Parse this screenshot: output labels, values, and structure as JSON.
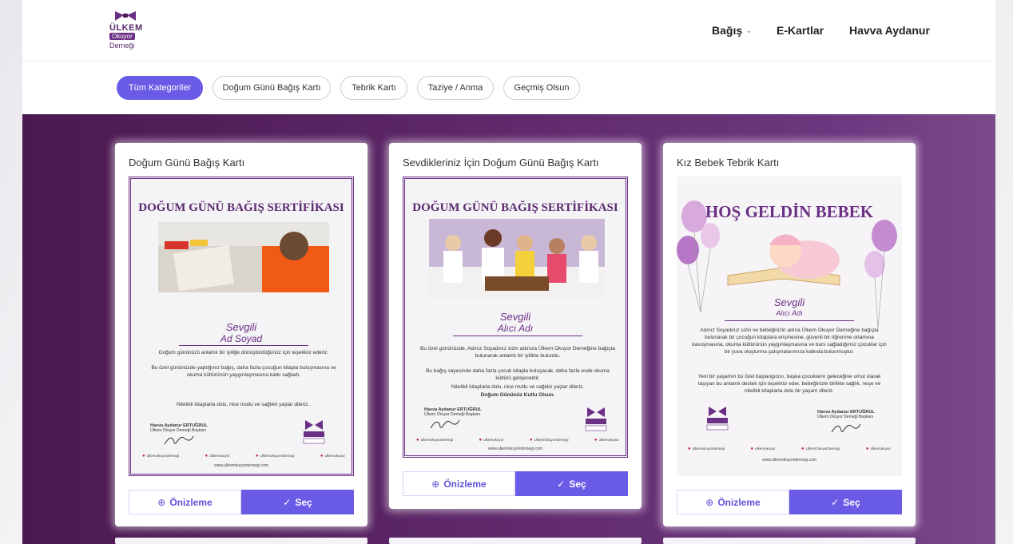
{
  "brand": {
    "logo_line1": "ÜLKEM",
    "logo_line2": "Okuyor",
    "logo_line3": "Derneği"
  },
  "nav": {
    "donate": "Bağış",
    "ecards": "E-Kartlar",
    "user": "Havva Aydanur"
  },
  "categories": [
    {
      "label": "Tüm Kategoriler",
      "active": true
    },
    {
      "label": "Doğum Günü Bağış Kartı",
      "active": false
    },
    {
      "label": "Tebrik Kartı",
      "active": false
    },
    {
      "label": "Taziye / Anma",
      "active": false
    },
    {
      "label": "Geçmiş Olsun",
      "active": false
    }
  ],
  "cards": [
    {
      "title": "Doğum Günü Bağış Kartı",
      "heading": "DOĞUM GÜNÜ BAĞIŞ SERTİFİKASI",
      "salutation": "Sevgili",
      "recipient": "Ad Soyad",
      "body1": "Doğum gününüzü anlamlı bir iyiliğe dönüştürdüğünüz için teşekkür ederiz.",
      "body2": "Bu özel gününüzde yaptığınız bağış, daha fazla çocuğun kitapla buluşmasına ve okuma kültürünün yaygınlaşmasına katkı sağladı.",
      "body3": "Nitelikli kitaplarla dolu, nice mutlu ve sağlıklı yaşlar dileriz..",
      "signer": "Havva Aydanur ERTUĞRUL",
      "signer_title": "Ülkem Okuyor Derneği Başkanı",
      "social": [
        "ulkemokuyordernegi",
        "ulkemokuyor",
        "UlkemOkuyorDernegi",
        "ulkemokuyor"
      ],
      "website": "www.ulkemokuyordernegi.com",
      "preview": "Önizleme",
      "select": "Seç"
    },
    {
      "title": "Sevdikleriniz İçin Doğum Günü Bağış Kartı",
      "heading": "DOĞUM GÜNÜ BAĞIŞ SERTİFİKASI",
      "salutation": "Sevgili",
      "recipient": "Alıcı Adı",
      "body1": "Bu özel gününüzde, Adınız Soyadınız sizin adınıza Ülkem Okuyor Derneğine bağışta bulunarak anlamlı bir iyilikte bulundu.",
      "body2": "Bu bağış sayesinde daha fazla çocuk kitapla buluşacak, daha fazla evde okuma kültürü gelişecektir.",
      "body3": "Nitelikli kitaplarla dolu, nice mutlu ve sağlıklı yaşlar dileriz.",
      "closing": "Doğum Gününüz Kutlu Olsun.",
      "signer": "Havva Aydanur ERTUĞRUL",
      "signer_title": "Ülkem Okuyor Derneği Başkanı",
      "social": [
        "ulkemokuyordernegi",
        "ulkemokuyor",
        "UlkemOkuyorDernegi",
        "ulkemokuyor"
      ],
      "website": "www.ulkemokuyordernegi.com",
      "preview": "Önizleme",
      "select": "Seç"
    },
    {
      "title": "Kız Bebek Tebrik Kartı",
      "heading": "HOŞ GELDİN BEBEK",
      "salutation": "Sevgili",
      "recipient": "Alıcı Adı",
      "body1": "Adınız Soyadınız sizin ve bebeğinizin adına Ülkem Okuyor Derneğine bağışta bulunarak bir çocuğun kitaplara erişmesine, güvenli bir öğrenme ortamına kavuşmasına, okuma kültürünün yaygınlaşmasına ve burs sağladığımız çocuklar için bir yuva oluşturma çalışmalarımıza katkıda bulunmuştur.",
      "body2": "Yeni bir yaşamın bu özel başlangıcını, başka çocukların geleceğine umut olarak taşıyan bu anlamlı destek için teşekkür eder, bebeğinizle birlikte sağlık, neşe ve nitelikli kitaplarla dolu bir yaşam dileriz.",
      "signer": "Havva Aydanur ERTUĞRUL",
      "signer_title": "Ülkem Okuyor Derneği Başkanı",
      "social": [
        "ulkemokuyordernegi",
        "ulkemokuyor",
        "UlkemOkuyorDernegi",
        "ulkemokuyor"
      ],
      "website": "www.ulkemokuyordernegi.com",
      "preview": "Önizleme",
      "select": "Seç"
    }
  ],
  "colors": {
    "accent": "#6a5be6",
    "brand_purple": "#6b2f85",
    "gallery_bg": "#5d2768"
  }
}
